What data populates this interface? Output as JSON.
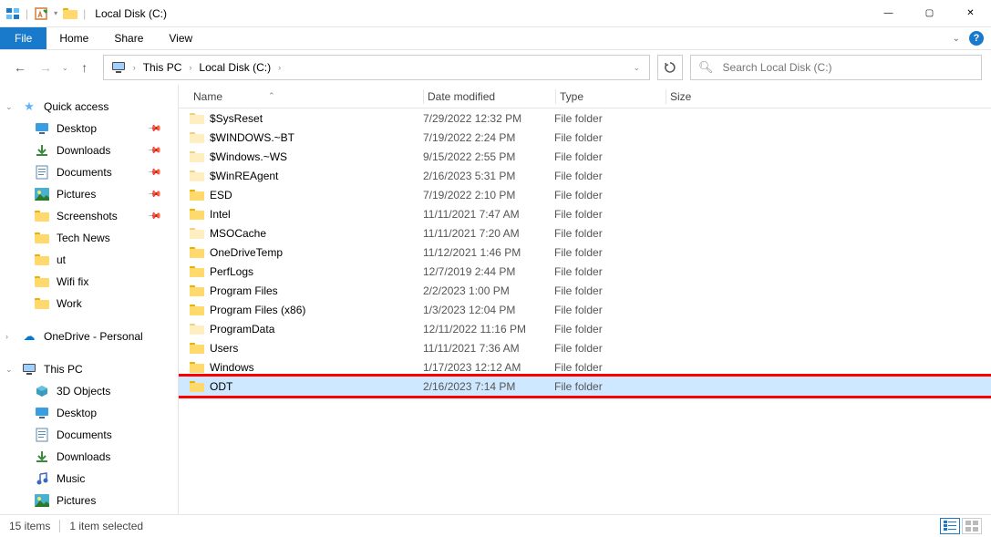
{
  "window": {
    "title": "Local Disk (C:)",
    "controls": {
      "min": "—",
      "max": "▢",
      "close": "✕"
    }
  },
  "ribbon": {
    "file": "File",
    "tabs": [
      "Home",
      "Share",
      "View"
    ]
  },
  "nav": {
    "breadcrumb": [
      "This PC",
      "Local Disk (C:)"
    ],
    "search_placeholder": "Search Local Disk (C:)"
  },
  "columns": {
    "name": "Name",
    "date": "Date modified",
    "type": "Type",
    "size": "Size"
  },
  "sidebar": {
    "quick_access": "Quick access",
    "quick_items": [
      {
        "label": "Desktop",
        "icon": "desktop",
        "pinned": true
      },
      {
        "label": "Downloads",
        "icon": "downloads",
        "pinned": true
      },
      {
        "label": "Documents",
        "icon": "documents",
        "pinned": true
      },
      {
        "label": "Pictures",
        "icon": "pictures",
        "pinned": true
      },
      {
        "label": "Screenshots",
        "icon": "folder",
        "pinned": true
      },
      {
        "label": "Tech News",
        "icon": "folder",
        "pinned": false
      },
      {
        "label": "ut",
        "icon": "folder",
        "pinned": false
      },
      {
        "label": "Wifi fix",
        "icon": "folder",
        "pinned": false
      },
      {
        "label": "Work",
        "icon": "folder",
        "pinned": false
      }
    ],
    "onedrive": "OneDrive - Personal",
    "this_pc": "This PC",
    "pc_items": [
      {
        "label": "3D Objects",
        "icon": "3d"
      },
      {
        "label": "Desktop",
        "icon": "desktop"
      },
      {
        "label": "Documents",
        "icon": "documents"
      },
      {
        "label": "Downloads",
        "icon": "downloads"
      },
      {
        "label": "Music",
        "icon": "music"
      },
      {
        "label": "Pictures",
        "icon": "pictures"
      }
    ]
  },
  "files": [
    {
      "name": "$SysReset",
      "date": "7/29/2022 12:32 PM",
      "type": "File folder",
      "faded": true
    },
    {
      "name": "$WINDOWS.~BT",
      "date": "7/19/2022 2:24 PM",
      "type": "File folder",
      "faded": true
    },
    {
      "name": "$Windows.~WS",
      "date": "9/15/2022 2:55 PM",
      "type": "File folder",
      "faded": true
    },
    {
      "name": "$WinREAgent",
      "date": "2/16/2023 5:31 PM",
      "type": "File folder",
      "faded": true
    },
    {
      "name": "ESD",
      "date": "7/19/2022 2:10 PM",
      "type": "File folder",
      "faded": false
    },
    {
      "name": "Intel",
      "date": "11/11/2021 7:47 AM",
      "type": "File folder",
      "faded": false
    },
    {
      "name": "MSOCache",
      "date": "11/11/2021 7:20 AM",
      "type": "File folder",
      "faded": true
    },
    {
      "name": "OneDriveTemp",
      "date": "11/12/2021 1:46 PM",
      "type": "File folder",
      "faded": false
    },
    {
      "name": "PerfLogs",
      "date": "12/7/2019 2:44 PM",
      "type": "File folder",
      "faded": false
    },
    {
      "name": "Program Files",
      "date": "2/2/2023 1:00 PM",
      "type": "File folder",
      "faded": false
    },
    {
      "name": "Program Files (x86)",
      "date": "1/3/2023 12:04 PM",
      "type": "File folder",
      "faded": false
    },
    {
      "name": "ProgramData",
      "date": "12/11/2022 11:16 PM",
      "type": "File folder",
      "faded": true
    },
    {
      "name": "Users",
      "date": "11/11/2021 7:36 AM",
      "type": "File folder",
      "faded": false
    },
    {
      "name": "Windows",
      "date": "1/17/2023 12:12 AM",
      "type": "File folder",
      "faded": false
    },
    {
      "name": "ODT",
      "date": "2/16/2023 7:14 PM",
      "type": "File folder",
      "faded": false,
      "selected": true
    }
  ],
  "status": {
    "count": "15 items",
    "selection": "1 item selected"
  }
}
